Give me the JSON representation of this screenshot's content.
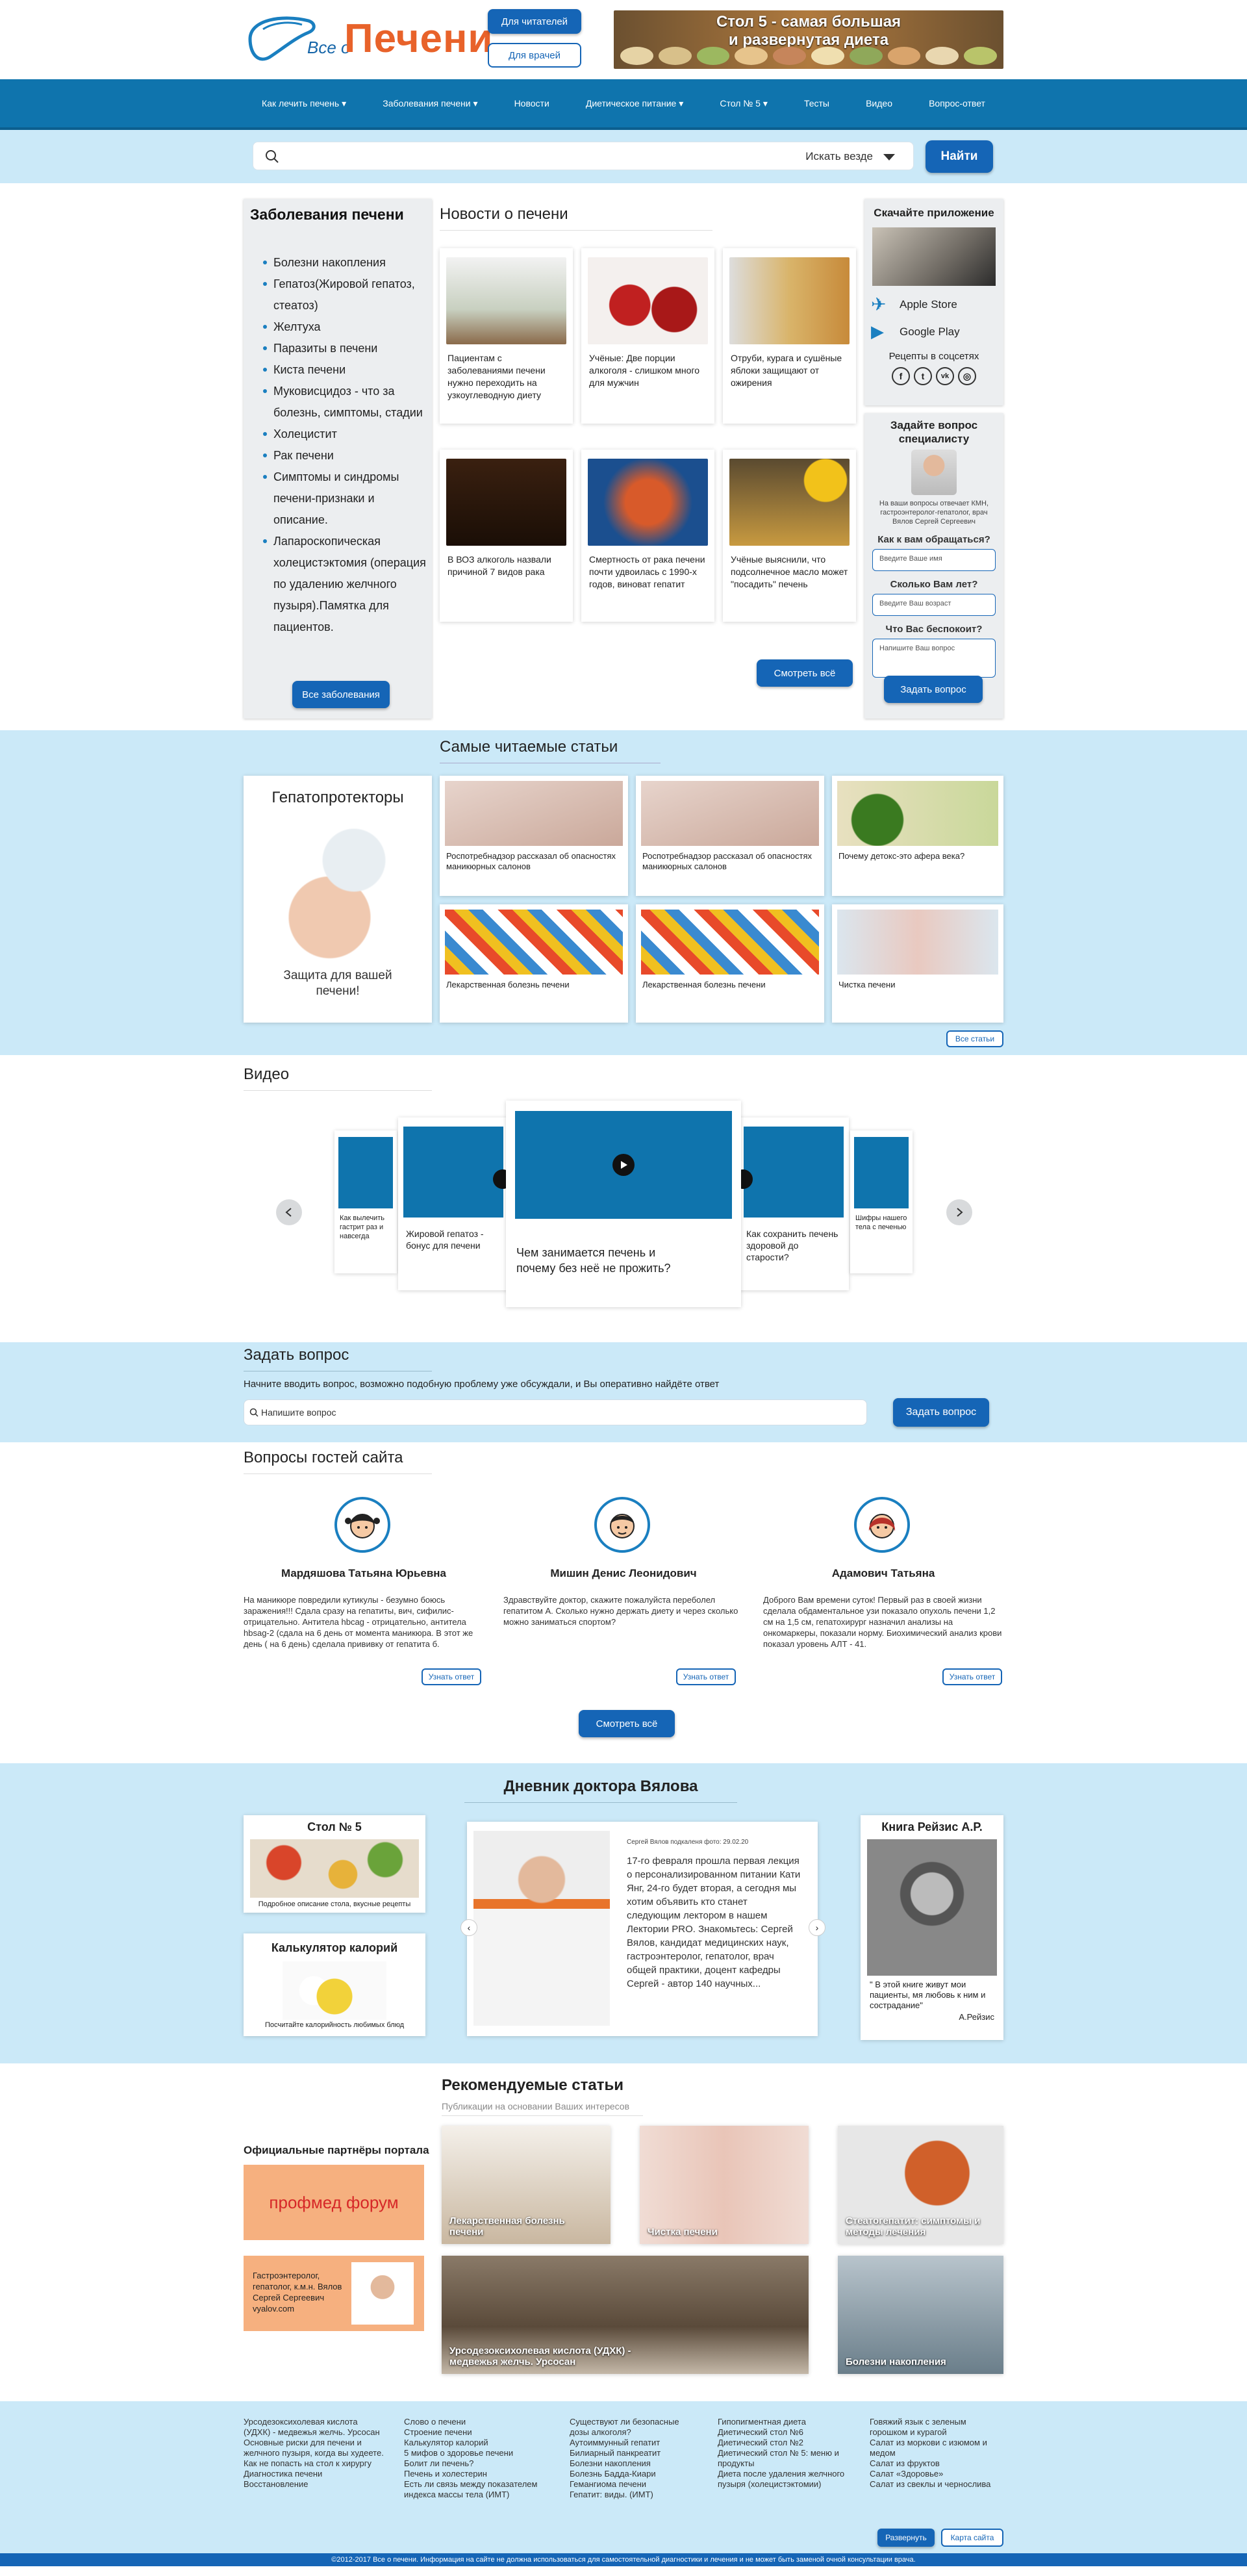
{
  "header": {
    "logo_small": "Все о",
    "logo_big": "Печени",
    "btn_readers": "Для читателей",
    "btn_doctors": "Для врачей",
    "banner_line1": "Стол 5 - самая большая",
    "banner_line2": "и развернутая диета"
  },
  "nav": [
    "Как лечить печень ▾",
    "Заболевания печени ▾",
    "Новости",
    "Диетическое питание ▾",
    "Стол № 5 ▾",
    "Тесты",
    "Видео",
    "Вопрос-ответ"
  ],
  "search": {
    "scope": "Искать везде",
    "button": "Найти"
  },
  "diseases": {
    "title": "Заболевания печени",
    "items": [
      "Болезни накопления",
      "Гепатоз(Жировой гепатоз, стеатоз)",
      "Желтуха",
      "Паразиты в печени",
      "Киста печени",
      "Муковисцидоз - что за болезнь, симптомы, стадии",
      "Холецистит",
      "Рак печени",
      "Симптомы и синдромы печени-признаки и описание.",
      "Лапароскопическая холецистэктомия (операция по удалению желчного пузыря).Памятка для пациентов."
    ],
    "button": "Все заболевания"
  },
  "news": {
    "title": "Новости о печени",
    "items": [
      {
        "text": "Пациентам с заболеваниями печени нужно переходить на узкоуглеводную диету"
      },
      {
        "text": "Учёные: Две порции алкоголя - слишком много для мужчин"
      },
      {
        "text": "Отруби, курага и сушёные яблоки защищают от ожирения"
      },
      {
        "text": "В ВОЗ алкоголь назвали причиной 7 видов рака"
      },
      {
        "text": "Смертность от рака печени почти удвоилась с 1990-х годов, виноват гепатит"
      },
      {
        "text": "Учёные выяснили, что подсолнечное масло может \"посадить\" печень"
      }
    ],
    "button": "Смотреть всё"
  },
  "app": {
    "title": "Скачайте приложение",
    "apple": "Apple Store",
    "google": "Google Play",
    "recipes": "Рецепты в соцсетях"
  },
  "ask_specialist": {
    "title": "Задайте вопрос специалисту",
    "answerer": "На ваши вопросы отвечает КМН, гастроэнтеролог-гепатолог, врач Вялов Сергей Сергеевич",
    "q_name": "Как к вам обращаться?",
    "ph_name": "Введите Ваше имя",
    "q_age": "Сколько Вам лет?",
    "ph_age": "Введите Ваш возраст",
    "q_worry": "Что Вас беспокоит?",
    "ph_worry": "Напишите Ваш вопрос",
    "button": "Задать вопрос"
  },
  "popular": {
    "title": "Самые читаемые статьи",
    "promo_title": "Гепатопротекторы",
    "promo_caption": "Защита для вашей печени!",
    "items": [
      {
        "text": "Роспотребнадзор рассказал об опасностях маникюрных салонов"
      },
      {
        "text": "Роспотребнадзор рассказал об опасностях маникюрных салонов"
      },
      {
        "text": "Почему детокс-это афера века?"
      },
      {
        "text": "Лекарственная болезнь печени"
      },
      {
        "text": "Лекарственная болезнь печени"
      },
      {
        "text": "Чистка печени"
      }
    ],
    "button": "Все статьи"
  },
  "video": {
    "title": "Видео",
    "items": [
      {
        "text": "Как вылечить гастрит раз и навсегда"
      },
      {
        "text": "Жировой гепатоз - бонус для печени"
      },
      {
        "text": "Чем занимается печень и почему без неё не прожить?"
      },
      {
        "text": "Как сохранить печень здоровой до старости?"
      },
      {
        "text": "Шифры нашего тела с печенью"
      }
    ]
  },
  "ask": {
    "title": "Задать вопрос",
    "subtitle": "Начните вводить вопрос, возможно подобную проблему уже обсуждали, и Вы оперативно найдёте ответ",
    "placeholder": "Напишите вопрос",
    "button": "Задать вопрос"
  },
  "guests": {
    "title": "Вопросы гостей сайта",
    "items": [
      {
        "name": "Мардяшова Татьяна Юрьевна",
        "text": "На маникюре повредили кутикулы - безумно боюсь заражения!!! Сдала сразу на гепатиты, вич, сифилис- отрицательно. Антитела hbcag - отрицательно, антитела hbsag-2 (сдала на 6 день от момента маникюра. В этот же день ( на 6 день) сделала прививку от гепатита б.",
        "button": "Узнать ответ"
      },
      {
        "name": "Мишин Денис Леонидович",
        "text": "Здравствуйте доктор, скажите пожалуйста переболел гепатитом А. Сколько нужно держать диету и через сколько можно заниматься спортом?",
        "button": "Узнать ответ"
      },
      {
        "name": "Адамович Татьяна",
        "text": "Доброго Вам времени суток! Первый раз в своей жизни сделала обдаментальное узи показало опухоль печени 1,2 см на 1,5 см, гепатохирург назначил анализы на онкомаркеры, показали норму. Биохимический анализ крови показал уровень АЛТ - 41.",
        "button": "Узнать ответ"
      }
    ],
    "button": "Смотреть всё"
  },
  "diary": {
    "title": "Дневник доктора Вялова",
    "left1_title": "Стол № 5",
    "left1_caption": "Подробное описание стола, вкусные рецепты",
    "left2_title": "Калькулятор калорий",
    "left2_caption": "Посчитайте калорийность любимых блюд",
    "center_meta": "Сергей Вялов подкаленя фото: 29.02.20",
    "center_text": "17-го февраля прошла первая лекция о персонализированном питании Кати Янг, 24-го будет вторая, а сегодня мы хотим объявить кто станет следующим лектором в нашем Лектории PRO. Знакомьтесь: Сергей Вялов, кандидат медицинских наук, гастроэнтеролог, гепатолог, врач общей практики, доцент кафедры Сергей - автор 140 научных...",
    "right_title": "Книга Рейзис А.Р.",
    "right_quote": "\" В этой книге живут мои пациенты, мя любовь к ним и сострадание\"",
    "right_author": "А.Рейзис"
  },
  "recommended": {
    "title": "Рекомендуемые статьи",
    "subtitle": "Публикации на основании Ваших интересов",
    "partners_title": "Официальные партнёры портала",
    "partner1": "профмед форум",
    "partner2": "Гастроэнтеролог, гепатолог, к.м.н. Вялов Сергей Сергеевич vyalov.com",
    "items": [
      {
        "text": "Лекарственная болезнь печени"
      },
      {
        "text": "Чистка печени"
      },
      {
        "text": "Стеатогепатит: симптомы и методы лечения"
      },
      {
        "text": "Урсодезоксихолевая кислота (УДХК) - медвежья желчь. Урсосан"
      },
      {
        "text": "Болезни накопления"
      }
    ]
  },
  "footer": {
    "col1": [
      "Урсодезоксихолевая кислота (УДХК) - медвежья желчь. Урсосан",
      "Основные риски для печени и желчного пузыря, когда вы худеете. Как не попасть на стол к хирургу",
      "Диагностика печени",
      "Восстановление"
    ],
    "col2": [
      "Слово о печени",
      "Строение печени",
      "Калькулятор калорий",
      "5 мифов о здоровье печени",
      "Болит ли печень?",
      "Печень и холестерин",
      "Есть ли связь между показателем индекса массы тела (ИМТ)"
    ],
    "col3": [
      "Существуют ли безопасные дозы алкоголя?",
      "Аутоиммунный гепатит",
      "Билиарный панкреатит",
      "Болезни накопления",
      "Болезнь Бадда-Киари",
      "Гемангиома печени",
      "Гепатит: виды. (ИМТ)"
    ],
    "col4": [
      "Гипопигментная диета",
      "Диетический стол №6",
      "Диетический стол №2",
      "Диетический стол № 5: меню и продукты",
      "Диета после удаления желчного пузыря (холецистэктомии)"
    ],
    "col5": [
      "Говяжий язык с зеленым горошком и курагой",
      "Салат из моркови с изюмом и медом",
      "Салат из фруктов",
      "Салат «Здоровье»",
      "Салат из свеклы и чернослива"
    ],
    "btn_expand": "Развернуть",
    "btn_map": "Карта сайта",
    "copyright": "©2012-2017 Все о печени. Информация на сайте не должна использоваться для самостоятельной диагностики и лечения и не может быть заменой очной консультации врача."
  }
}
